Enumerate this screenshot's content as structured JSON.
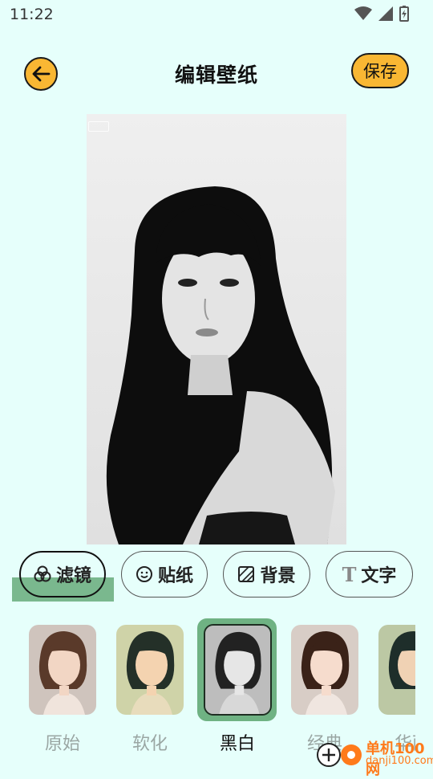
{
  "status": {
    "time": "11:22"
  },
  "header": {
    "title": "编辑壁纸",
    "save_label": "保存"
  },
  "tabs": [
    {
      "label": "滤镜",
      "icon": "filter-circles-icon",
      "active": true
    },
    {
      "label": "贴纸",
      "icon": "smiley-icon",
      "active": false
    },
    {
      "label": "背景",
      "icon": "background-hatch-icon",
      "active": false
    },
    {
      "label": "文字",
      "icon": "text-T-icon",
      "active": false
    }
  ],
  "filters": [
    {
      "label": "原始",
      "selected": false
    },
    {
      "label": "软化",
      "selected": false
    },
    {
      "label": "黑白",
      "selected": true
    },
    {
      "label": "经典",
      "selected": false
    },
    {
      "label": "华丽",
      "selected": false
    }
  ],
  "watermark": {
    "line1": "单机100网",
    "line2": "danji100.com"
  },
  "colors": {
    "background": "#e6fffb",
    "accent": "#f9b733",
    "selected": "#6fb283"
  }
}
